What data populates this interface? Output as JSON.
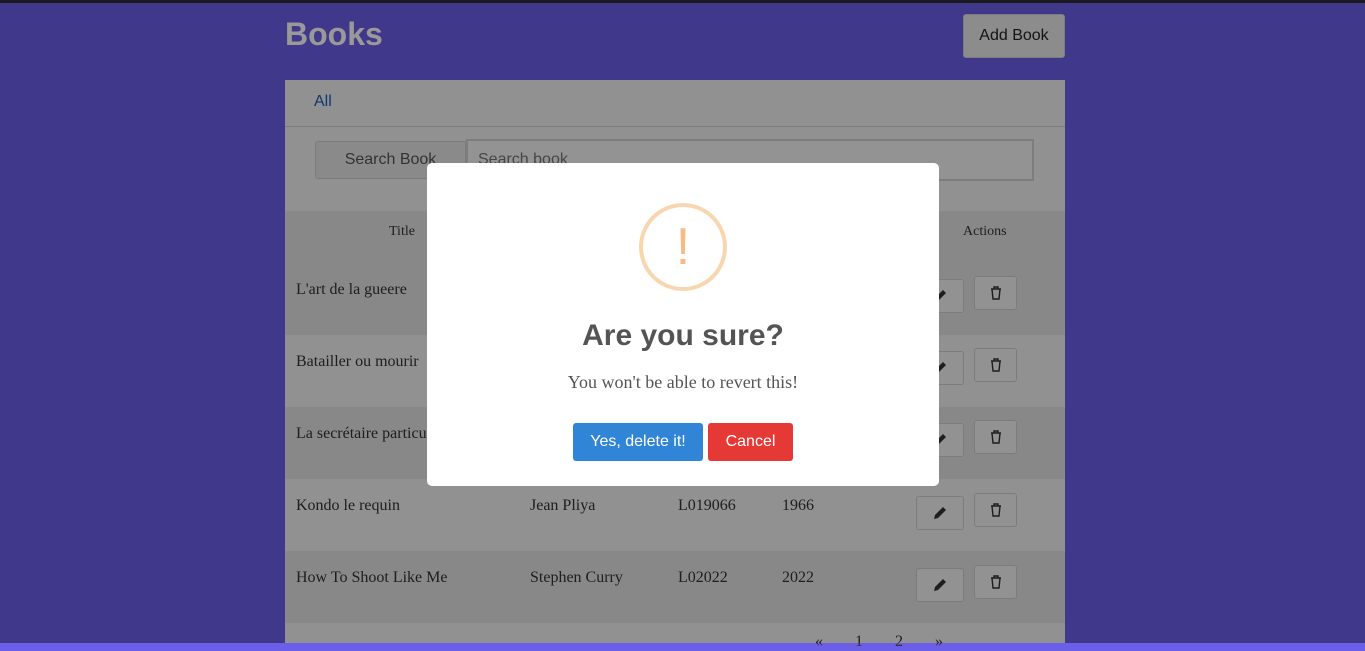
{
  "header": {
    "title": "Books",
    "add_button": "Add Book"
  },
  "tabs": [
    {
      "label": "All"
    }
  ],
  "search": {
    "button_label": "Search Book",
    "placeholder": "Search book",
    "value": ""
  },
  "table": {
    "columns": {
      "title": "Title",
      "actions": "Actions"
    },
    "rows": [
      {
        "title": "L'art de la gueere",
        "author": "",
        "code": "",
        "year": ""
      },
      {
        "title": "Batailler ou mourir",
        "author": "",
        "code": "",
        "year": ""
      },
      {
        "title": "La secrétaire particu",
        "author": "",
        "code": "",
        "year": ""
      },
      {
        "title": "Kondo le requin",
        "author": "Jean Pliya",
        "code": "L019066",
        "year": "1966"
      },
      {
        "title": "How To Shoot Like Me",
        "author": "Stephen Curry",
        "code": "L02022",
        "year": "2022"
      }
    ]
  },
  "pagination": {
    "prev": "«",
    "pages": [
      "1",
      "2"
    ],
    "next": "»"
  },
  "dialog": {
    "icon": "warning-exclamation-icon",
    "icon_glyph": "!",
    "title": "Are you sure?",
    "text": "You won't be able to revert this!",
    "confirm_label": "Yes, delete it!",
    "cancel_label": "Cancel"
  },
  "colors": {
    "background": "#6b5ee8",
    "confirm": "#3085d6",
    "cancel": "#e53935",
    "warning": "#f8bb86"
  }
}
